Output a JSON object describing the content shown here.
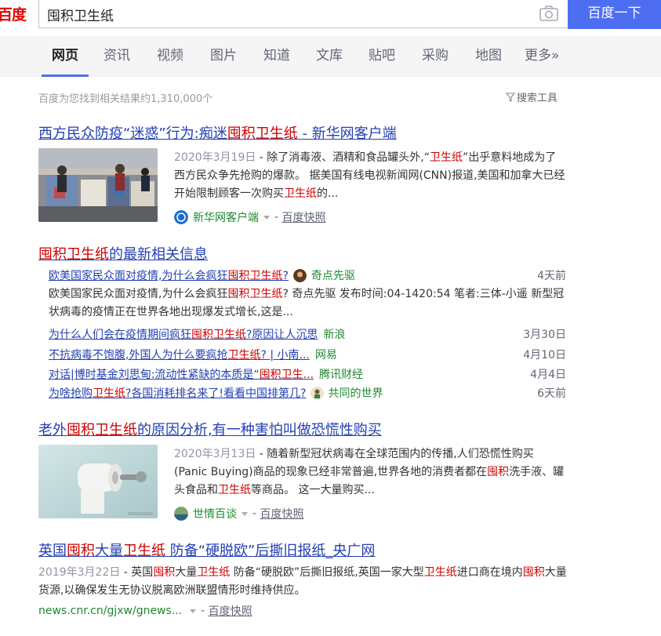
{
  "logo": {
    "text": "百度"
  },
  "search": {
    "query": "囤积卫生纸",
    "button_label": "百度一下"
  },
  "tabs": [
    "网页",
    "资讯",
    "视频",
    "图片",
    "知道",
    "文库",
    "贴吧",
    "采购",
    "地图",
    "更多»"
  ],
  "result_count": "百度为您找到相关结果约1,310,000个",
  "search_tools": "搜索工具",
  "results": [
    {
      "title_pre": "西方民众防疫“迷惑”行为:痴迷",
      "title_em": "囤积卫生纸",
      "title_post": " - 新华网客户端",
      "date": "2020年3月19日",
      "abs_a": " - 除了消毒液、酒精和食品罐头外,“",
      "abs_em1": "卫生纸",
      "abs_b": "”出乎意料地成为了西方民众争先抢购的爆款。 据美国有线电视新闻网(CNN)报道,美国和加拿大已经开始限制顾客一次购买",
      "abs_em2": "卫生纸",
      "abs_c": "的...",
      "source": "新华网客户端",
      "cache": "百度快照"
    },
    {
      "title_pre": "老外",
      "title_em": "囤积卫生纸",
      "title_post": "的原因分析,有一种害怕叫做恐慌性购买",
      "date": "2020年3月13日",
      "abs_a": " - 随着新型冠状病毒在全球范围内的传播,人们恐慌性购买(Panic Buying)商品的现象已经非常普遍,世界各地的消费者都在",
      "abs_em1": "囤积",
      "abs_b": "洗手液、罐头食品和",
      "abs_em2": "卫生纸",
      "abs_c": "等商品。 这一大量购买...",
      "source": "世情百谈",
      "cache": "百度快照"
    },
    {
      "title_a": "英国",
      "title_em1": "囤积",
      "title_b": "大量",
      "title_em2": "卫生纸",
      "title_c": " 防备“硬脱欧”后撕旧报纸_央广网",
      "date": "2019年3月22日",
      "abs_a": " - 英国",
      "abs_em1": "囤积",
      "abs_b": "大量",
      "abs_em2": "卫生纸",
      "abs_c": " 防备“硬脱欧”后撕旧报纸,英国一家大型",
      "abs_em3": "卫生纸",
      "abs_d": "进口商在境内",
      "abs_em4": "囤积",
      "abs_e": "大量货源,以确保发生无协议脱离欧洲联盟情形时维持供应。",
      "url": "news.cnr.cn/gjxw/gnews...",
      "cache": "百度快照"
    }
  ],
  "news": {
    "title_em": "囤积卫生纸",
    "title_post": "的最新相关信息",
    "top": {
      "pre": "欧美国家民众面对疫情,为什么会疯狂",
      "em": "囤积卫生纸",
      "post": "?",
      "source": "奇点先驱",
      "time": "4天前",
      "summary_pre": "欧美国家民众面对疫情,为什么会疯狂",
      "summary_em": "囤积卫生纸",
      "summary_post": "? 奇点先驱 发布时间:04-1420:54 笔者:三体-小遥 新型冠状病毒的疫情正在世界各地出现爆发式增长,这是..."
    },
    "items": [
      {
        "pre": "为什么人们会在疫情期间疯狂",
        "em": "囤积卫生纸",
        "post": "?原因让人沉思",
        "source": "新浪",
        "time": "3月30日"
      },
      {
        "pre": "不抗病毒不饱腹,外国人为什么要疯抢",
        "em": "卫生纸",
        "post": "? | 小南...",
        "source": "网易",
        "time": "4月10日"
      },
      {
        "pre": "对话|博时基金刘思甸:流动性紧缺的本质是“",
        "em": "囤积卫生...",
        "post": "",
        "source": "腾讯财经",
        "time": "4月4日"
      },
      {
        "pre": "为啥抢购",
        "em": "卫生纸",
        "post": "?各国消耗排名来了!看看中国排第几?",
        "source": "共同的世界",
        "time": "6天前"
      }
    ]
  },
  "colors": {
    "accent": "#4e6ef2",
    "link": "#2440b3",
    "highlight": "#cc0000",
    "source_green": "#1e8a2f"
  }
}
